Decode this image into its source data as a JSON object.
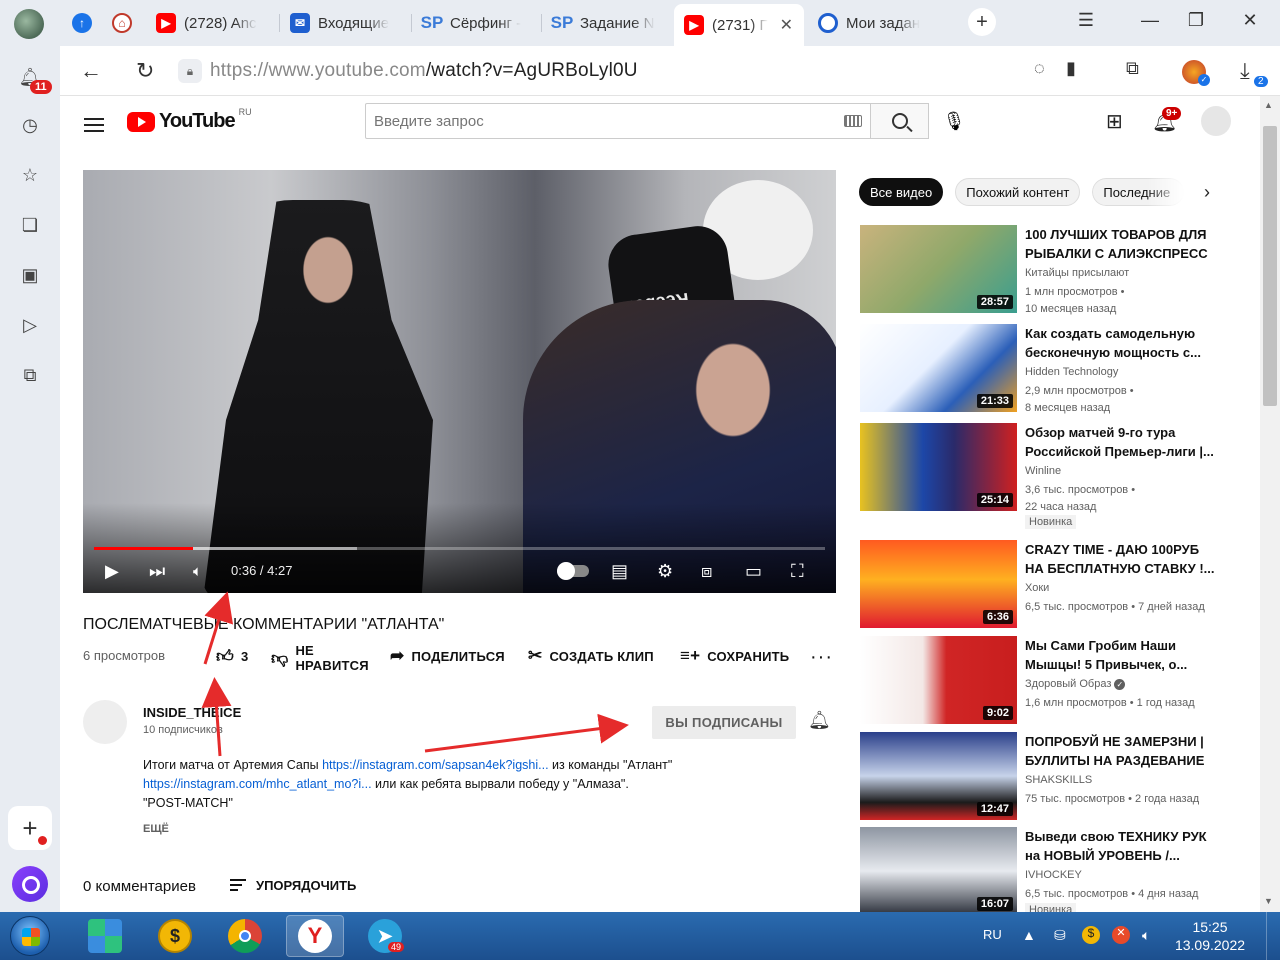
{
  "browser": {
    "tabs": [
      {
        "label": "",
        "icon": "cloud-upload-icon",
        "color": "#1a73e8"
      },
      {
        "label": "",
        "icon": "app-icon",
        "color": "#c0392b"
      },
      {
        "label": "(2728) Anc",
        "icon": "youtube-icon",
        "color": "#ff0000"
      },
      {
        "label": "Входящие",
        "icon": "mail-icon",
        "color": "#1f5fcf"
      },
      {
        "label": "Сёрфинг -",
        "icon": "sp-icon",
        "color": "#3b7bd8"
      },
      {
        "label": "Задание N",
        "icon": "sp-icon",
        "color": "#3b7bd8"
      },
      {
        "label": "(2731) Г",
        "icon": "youtube-icon",
        "color": "#ff0000"
      },
      {
        "label": "Мои задан",
        "icon": "target-icon",
        "color": "#1f5fcf"
      }
    ],
    "url_host": "https://www.youtube.com",
    "url_path": "/watch?v=AgURBoLyl0U",
    "notifications_count": "11",
    "downloads_count": "2"
  },
  "youtube": {
    "region": "RU",
    "logo_text": "YouTube",
    "search_placeholder": "Введите запрос",
    "notif_badge": "9+",
    "video": {
      "title": "ПОСЛЕМАТЧЕВЫЕ КОММЕНТАРИИ \"АТЛАНТА\"",
      "time": "0:36 / 4:27",
      "played_fraction": 0.135,
      "buffered_fraction": 0.36,
      "views": "6 просмотров",
      "likes": "3",
      "dislike_label_1": "НЕ",
      "dislike_label_2": "НРАВИТСЯ",
      "share_label": "ПОДЕЛИТЬСЯ",
      "clip_label": "СОЗДАТЬ КЛИП",
      "save_label": "СОХРАНИТЬ"
    },
    "channel": {
      "name": "INSIDE_THEICE",
      "subscribers": "10 подписчиков",
      "subscribed_label": "ВЫ ПОДПИСАНЫ"
    },
    "description": {
      "line1_text": "Итоги матча от Артемия Сапы ",
      "line1_link": "https://instagram.com/sapsan4ek?igshi...",
      "line1_end": " из команды \"Атлант\"",
      "line2_link": "https://instagram.com/mhc_atlant_mo?i...",
      "line2_end": " или как ребята вырвали победу у \"Алмаза\".",
      "line3": "\"POST-MATCH\"",
      "more_label": "ЕЩЁ"
    },
    "comments_count": "0 комментариев",
    "sort_label": "УПОРЯДОЧИТЬ",
    "chips": [
      "Все видео",
      "Похожий контент",
      "Последние"
    ],
    "recommendations": [
      {
        "title": "100 ЛУЧШИХ ТОВАРОВ ДЛЯ РЫБАЛКИ С АЛИЭКСПРЕСС ...",
        "channel": "Китайцы присылают",
        "meta1": "1 млн просмотров •",
        "meta2": "10 месяцев назад",
        "duration": "28:57",
        "badge": "",
        "thumb": "linear-gradient(135deg,#c9b37d,#8fa86a 50%,#3a9e8f)"
      },
      {
        "title": "Как создать самодельную бесконечную мощность с...",
        "channel": "Hidden Technology",
        "meta1": "2,9 млн просмотров •",
        "meta2": "8 месяцев назад",
        "duration": "21:33",
        "badge": "",
        "thumb": "linear-gradient(135deg,#ffffff,#e7f0ff 45%,#2b5fb8 70%,#f0a020)"
      },
      {
        "title": "Обзор матчей 9-го тура Российской Премьер-лиги |...",
        "channel": "Winline",
        "meta1": "3,6 тыс. просмотров •",
        "meta2": "22 часа назад",
        "duration": "25:14",
        "badge": "Новинка",
        "thumb": "linear-gradient(90deg,#e8c220,#1d47a8 40%,#2a2a6a 60%,#d02020)"
      },
      {
        "title": "CRAZY TIME - ДАЮ 100РУБ НА БЕСПЛАТНУЮ СТАВКУ !...",
        "channel": "Хоки",
        "meta1": "6,5 тыс. просмотров • 7 дней назад",
        "meta2": "",
        "duration": "6:36",
        "badge": "",
        "thumb": "linear-gradient(180deg,#ff5a20,#ffb020 45%,#e01a30)"
      },
      {
        "title": "Мы Сами Гробим Наши Мышцы! 5 Привычек, о...",
        "channel": "Здоровый Образ",
        "meta1": "1,6 млн просмотров • 1 год назад",
        "meta2": "",
        "duration": "9:02",
        "badge": "",
        "verified": true,
        "thumb": "linear-gradient(90deg,#ffffff 0%,#f3e8e6 40%,#d02525 55%,#c81e1e)"
      },
      {
        "title": "ПОПРОБУЙ НЕ ЗАМЕРЗНИ | БУЛЛИТЫ НА РАЗДЕВАНИЕ",
        "channel": "SHAKSKILLS",
        "meta1": "75 тыс. просмотров • 2 года назад",
        "meta2": "",
        "duration": "12:47",
        "badge": "",
        "thumb": "linear-gradient(180deg,#2a3f8a,#c7d3ea 50%,#1b1b1b 80%,#d02525)"
      },
      {
        "title": "Выведи свою ТЕХНИКУ РУК на НОВЫЙ УРОВЕНЬ /...",
        "channel": "IVHOCKEY",
        "meta1": "6,5 тыс. просмотров • 4 дня назад",
        "meta2": "",
        "duration": "16:07",
        "badge": "Новинка",
        "thumb": "linear-gradient(180deg,#8e96a2,#e7eaef 50%,#2a2f3a)"
      }
    ]
  },
  "taskbar": {
    "telegram_badge": "49",
    "lang": "RU",
    "time": "15:25",
    "date": "13.09.2022"
  }
}
